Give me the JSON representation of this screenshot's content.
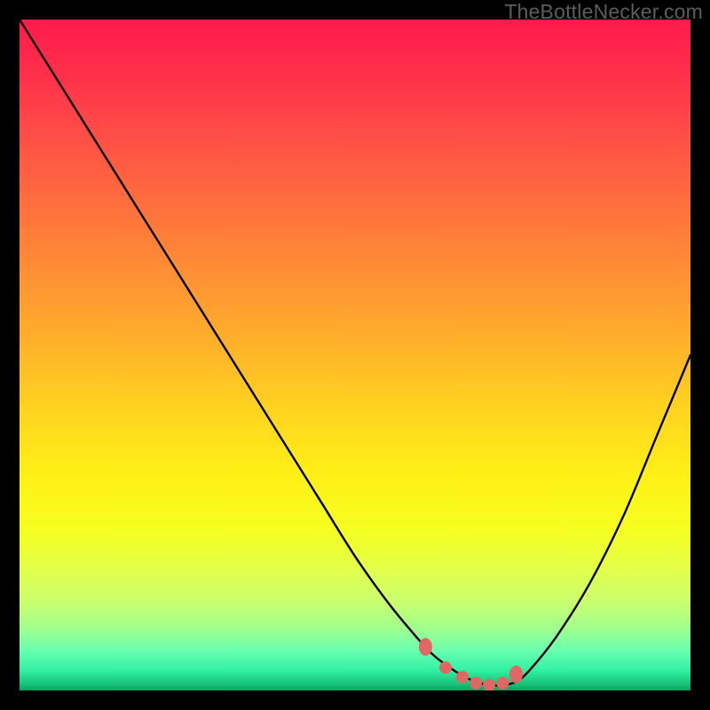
{
  "watermark": "TheBottleNecker.com",
  "colors": {
    "curve_stroke": "#000000",
    "marker_fill": "#e06763",
    "marker_stroke": "#c24f4b",
    "frame_bg": "#000000"
  },
  "chart_data": {
    "type": "line",
    "title": "",
    "xlabel": "",
    "ylabel": "",
    "xlim": [
      0,
      100
    ],
    "ylim": [
      0,
      100
    ],
    "x": [
      0,
      5,
      10,
      15,
      20,
      25,
      30,
      35,
      40,
      45,
      50,
      55,
      60,
      62,
      64,
      66,
      68,
      70,
      72,
      74,
      76,
      80,
      85,
      90,
      95,
      100
    ],
    "values": [
      100,
      92,
      84,
      76,
      68,
      60,
      52,
      44,
      36,
      28,
      20,
      13,
      7,
      5,
      3.5,
      2.2,
      1.3,
      0.8,
      0.8,
      1.3,
      3,
      8,
      16,
      26,
      38,
      50
    ],
    "markers": {
      "x": [
        60.5,
        63.5,
        66,
        68,
        70,
        72,
        74
      ],
      "y": [
        6.5,
        3.4,
        2.0,
        1.1,
        0.8,
        1.1,
        2.4
      ]
    },
    "gradient_stops": [
      {
        "offset": 0,
        "color": "#ff1a4d"
      },
      {
        "offset": 8,
        "color": "#ff2f4a"
      },
      {
        "offset": 16,
        "color": "#ff4a47"
      },
      {
        "offset": 26,
        "color": "#ff6a3e"
      },
      {
        "offset": 36,
        "color": "#ff8a36"
      },
      {
        "offset": 48,
        "color": "#ffb02a"
      },
      {
        "offset": 58,
        "color": "#ffd31f"
      },
      {
        "offset": 68,
        "color": "#fff016"
      },
      {
        "offset": 76,
        "color": "#f6ff20"
      },
      {
        "offset": 82,
        "color": "#e2ff4a"
      },
      {
        "offset": 87,
        "color": "#c8ff70"
      },
      {
        "offset": 91,
        "color": "#9dff90"
      },
      {
        "offset": 94,
        "color": "#6affb0"
      },
      {
        "offset": 97,
        "color": "#32f0a2"
      },
      {
        "offset": 99,
        "color": "#18c47a"
      },
      {
        "offset": 100,
        "color": "#0f9f5e"
      }
    ]
  }
}
